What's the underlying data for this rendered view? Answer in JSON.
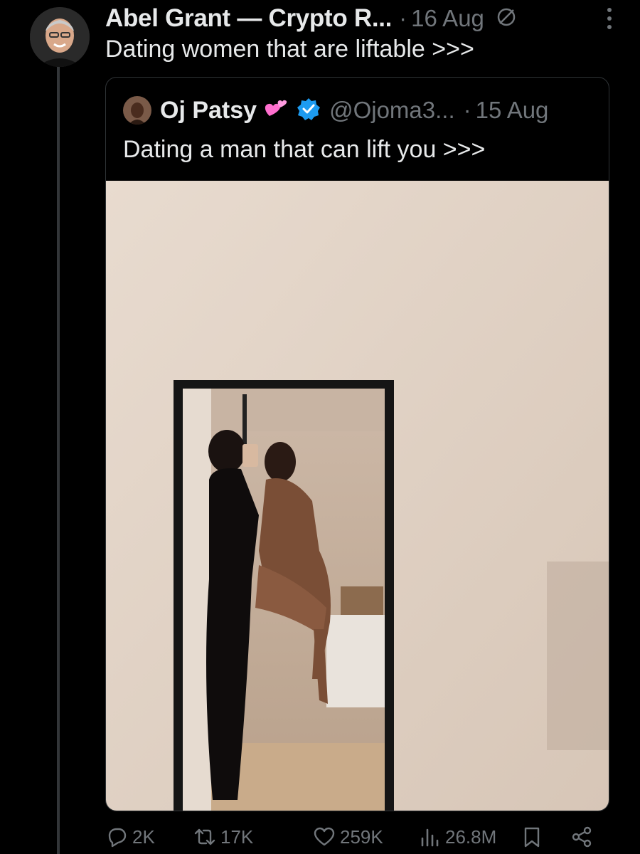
{
  "post": {
    "author_name": "Abel Grant — Crypto R...",
    "separator": "·",
    "date": "16 Aug",
    "text": "Dating women that are liftable >>>",
    "status_icon": "slash-circle-icon",
    "more_icon": "more-vertical-icon"
  },
  "quote": {
    "author_name": "Oj Patsy",
    "emoji_icon": "two-hearts-icon",
    "verified_icon": "verified-badge-icon",
    "handle": "@Ojoma3...",
    "separator": "·",
    "date": "15 Aug",
    "text": "Dating a man that can lift you >>>",
    "media": "photo-mirror-selfie-couple"
  },
  "actions": {
    "replies": "2K",
    "reposts": "17K",
    "likes": "259K",
    "views": "26.8M"
  },
  "colors": {
    "background": "#000000",
    "text_primary": "#e7e9ea",
    "text_secondary": "#71767b",
    "border": "#2f3336",
    "verified_blue": "#1d9bf0",
    "heart_pink": "#f91880"
  }
}
